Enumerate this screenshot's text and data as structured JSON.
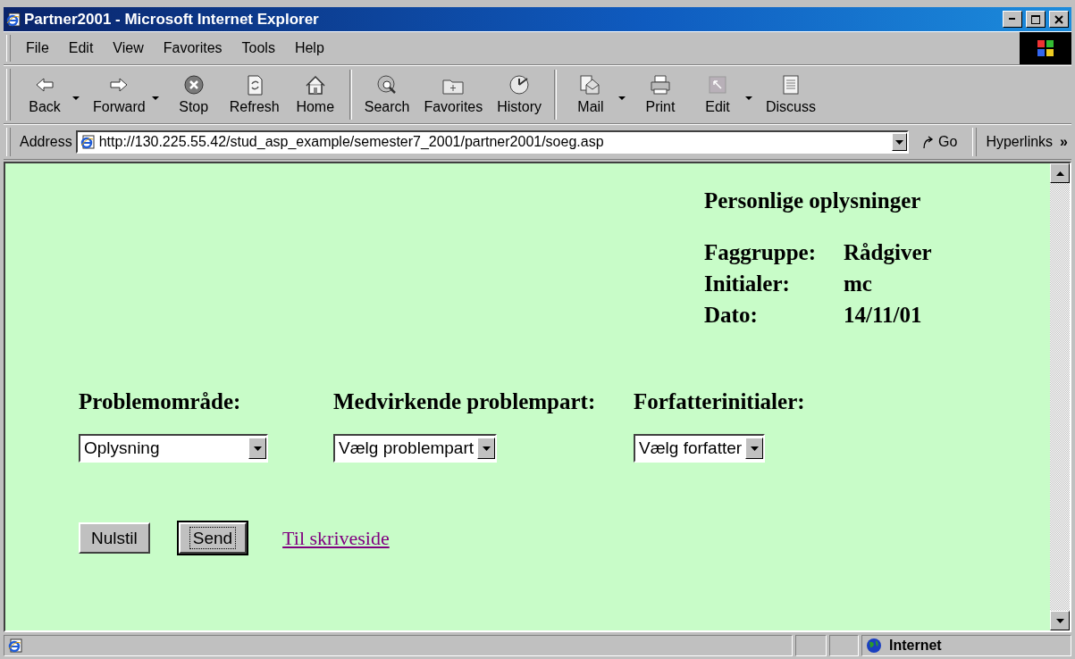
{
  "window": {
    "title": "Partner2001 - Microsoft Internet Explorer"
  },
  "menu": [
    "File",
    "Edit",
    "View",
    "Favorites",
    "Tools",
    "Help"
  ],
  "toolbar": {
    "groups": [
      [
        {
          "label": "Back",
          "kind": "back",
          "dropdown": true
        },
        {
          "label": "Forward",
          "kind": "forward",
          "dropdown": true
        },
        {
          "label": "Stop",
          "kind": "stop",
          "dropdown": false
        },
        {
          "label": "Refresh",
          "kind": "refresh",
          "dropdown": false
        },
        {
          "label": "Home",
          "kind": "home",
          "dropdown": false
        }
      ],
      [
        {
          "label": "Search",
          "kind": "search",
          "dropdown": false
        },
        {
          "label": "Favorites",
          "kind": "favorites",
          "dropdown": false
        },
        {
          "label": "History",
          "kind": "history",
          "dropdown": false
        }
      ],
      [
        {
          "label": "Mail",
          "kind": "mail",
          "dropdown": true
        },
        {
          "label": "Print",
          "kind": "print",
          "dropdown": false
        },
        {
          "label": "Edit",
          "kind": "edit",
          "dropdown": true
        },
        {
          "label": "Discuss",
          "kind": "discuss",
          "dropdown": false
        }
      ]
    ]
  },
  "address_bar": {
    "label": "Address",
    "value": "http://130.225.55.42/stud_asp_example/semester7_2001/partner2001/soeg.asp",
    "go": "Go",
    "links": "Hyperlinks",
    "more": "»"
  },
  "page": {
    "info": {
      "heading": "Personlige oplysninger",
      "rows": [
        {
          "label": "Faggruppe:",
          "value": "Rådgiver"
        },
        {
          "label": "Initialer:",
          "value": "mc"
        },
        {
          "label": "Dato:",
          "value": "14/11/01"
        }
      ]
    },
    "fields": [
      {
        "label": "Problemområde:",
        "value": "Oplysning"
      },
      {
        "label": "Medvirkende problempart:",
        "value": "Vælg problempart"
      },
      {
        "label": "Forfatterinitialer:",
        "value": "Vælg forfatter"
      }
    ],
    "buttons": [
      {
        "label": "Nulstil",
        "focused": false
      },
      {
        "label": "Send",
        "focused": true
      }
    ],
    "link": "Til skriveside"
  },
  "status_bar": {
    "zone": "Internet"
  }
}
